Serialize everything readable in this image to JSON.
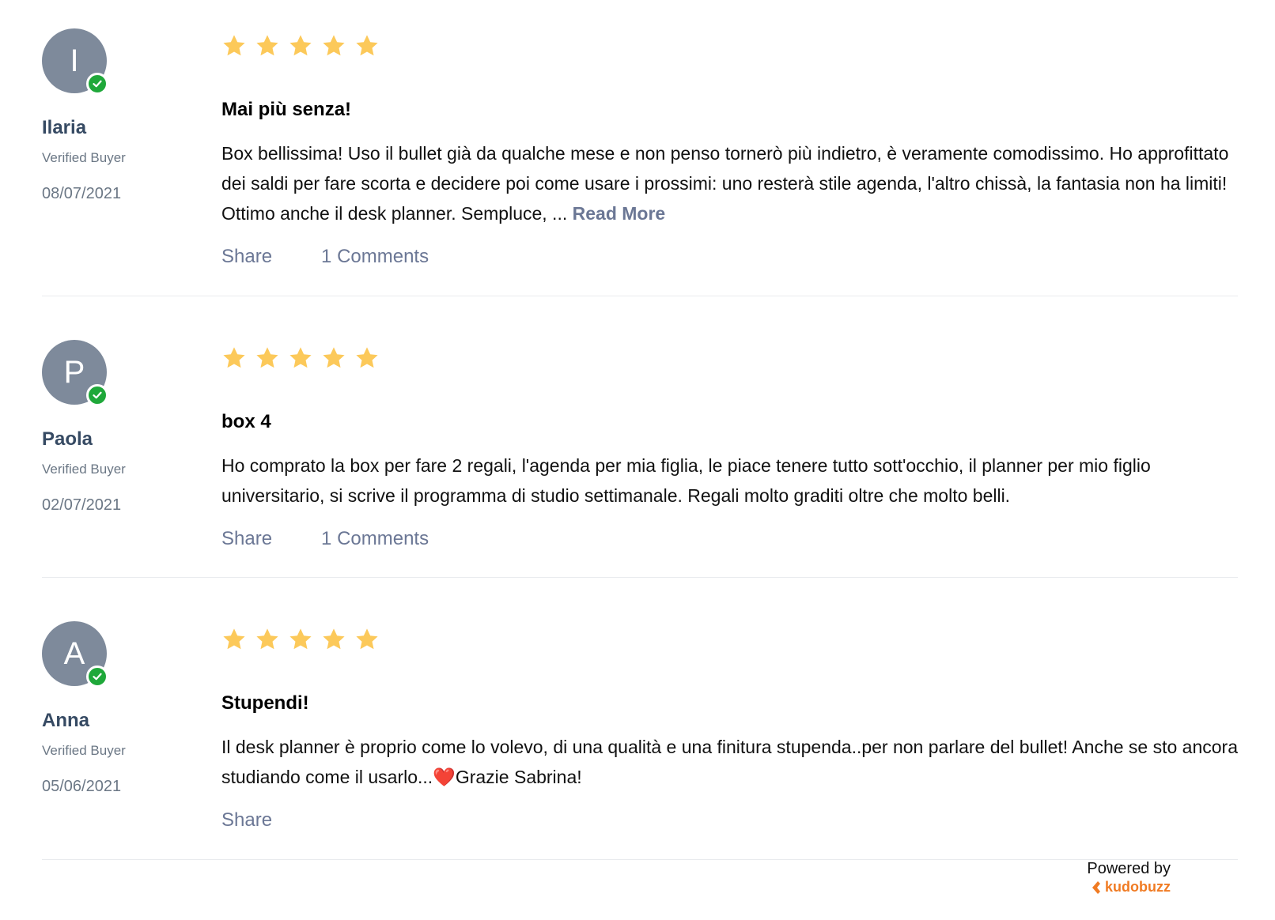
{
  "reviews": [
    {
      "initial": "I",
      "name": "Ilaria",
      "verified": "Verified Buyer",
      "date": "08/07/2021",
      "rating": 5,
      "title": "Mai più senza!",
      "body": "Box bellissima! Uso il bullet già da qualche mese e non penso tornerò più indietro, è veramente comodissimo. Ho approfittato dei saldi per fare scorta e decidere poi come usare i prossimi: uno resterà stile agenda, l'altro chissà, la fantasia non ha limiti! Ottimo anche il desk planner. Sempluce, ...",
      "read_more": "Read More",
      "share": "Share",
      "comments": "1 Comments"
    },
    {
      "initial": "P",
      "name": "Paola",
      "verified": "Verified Buyer",
      "date": "02/07/2021",
      "rating": 5,
      "title": "box 4",
      "body": "Ho comprato la box per fare 2 regali, l'agenda per mia figlia, le piace tenere tutto sott'occhio, il planner per mio figlio universitario, si scrive il programma di studio settimanale. Regali molto graditi oltre che molto belli.",
      "share": "Share",
      "comments": "1 Comments"
    },
    {
      "initial": "A",
      "name": "Anna",
      "verified": "Verified Buyer",
      "date": "05/06/2021",
      "rating": 5,
      "title": "Stupendi!",
      "body_before_heart": "Il desk planner è proprio come lo volevo, di una qualità e una finitura stupenda..per non parlare del bullet! Anche se sto ancora studiando come il usarlo...",
      "heart": "❤️",
      "body_after_heart": "Grazie Sabrina!",
      "share": "Share"
    }
  ],
  "footer": {
    "powered_by": "Powered by",
    "brand": "kudobuzz"
  },
  "colors": {
    "star": "#fcc95a",
    "avatar": "#7e8a9b",
    "verified_badge": "#1fa83a",
    "brand": "#f07b23",
    "link": "#6b7795"
  }
}
